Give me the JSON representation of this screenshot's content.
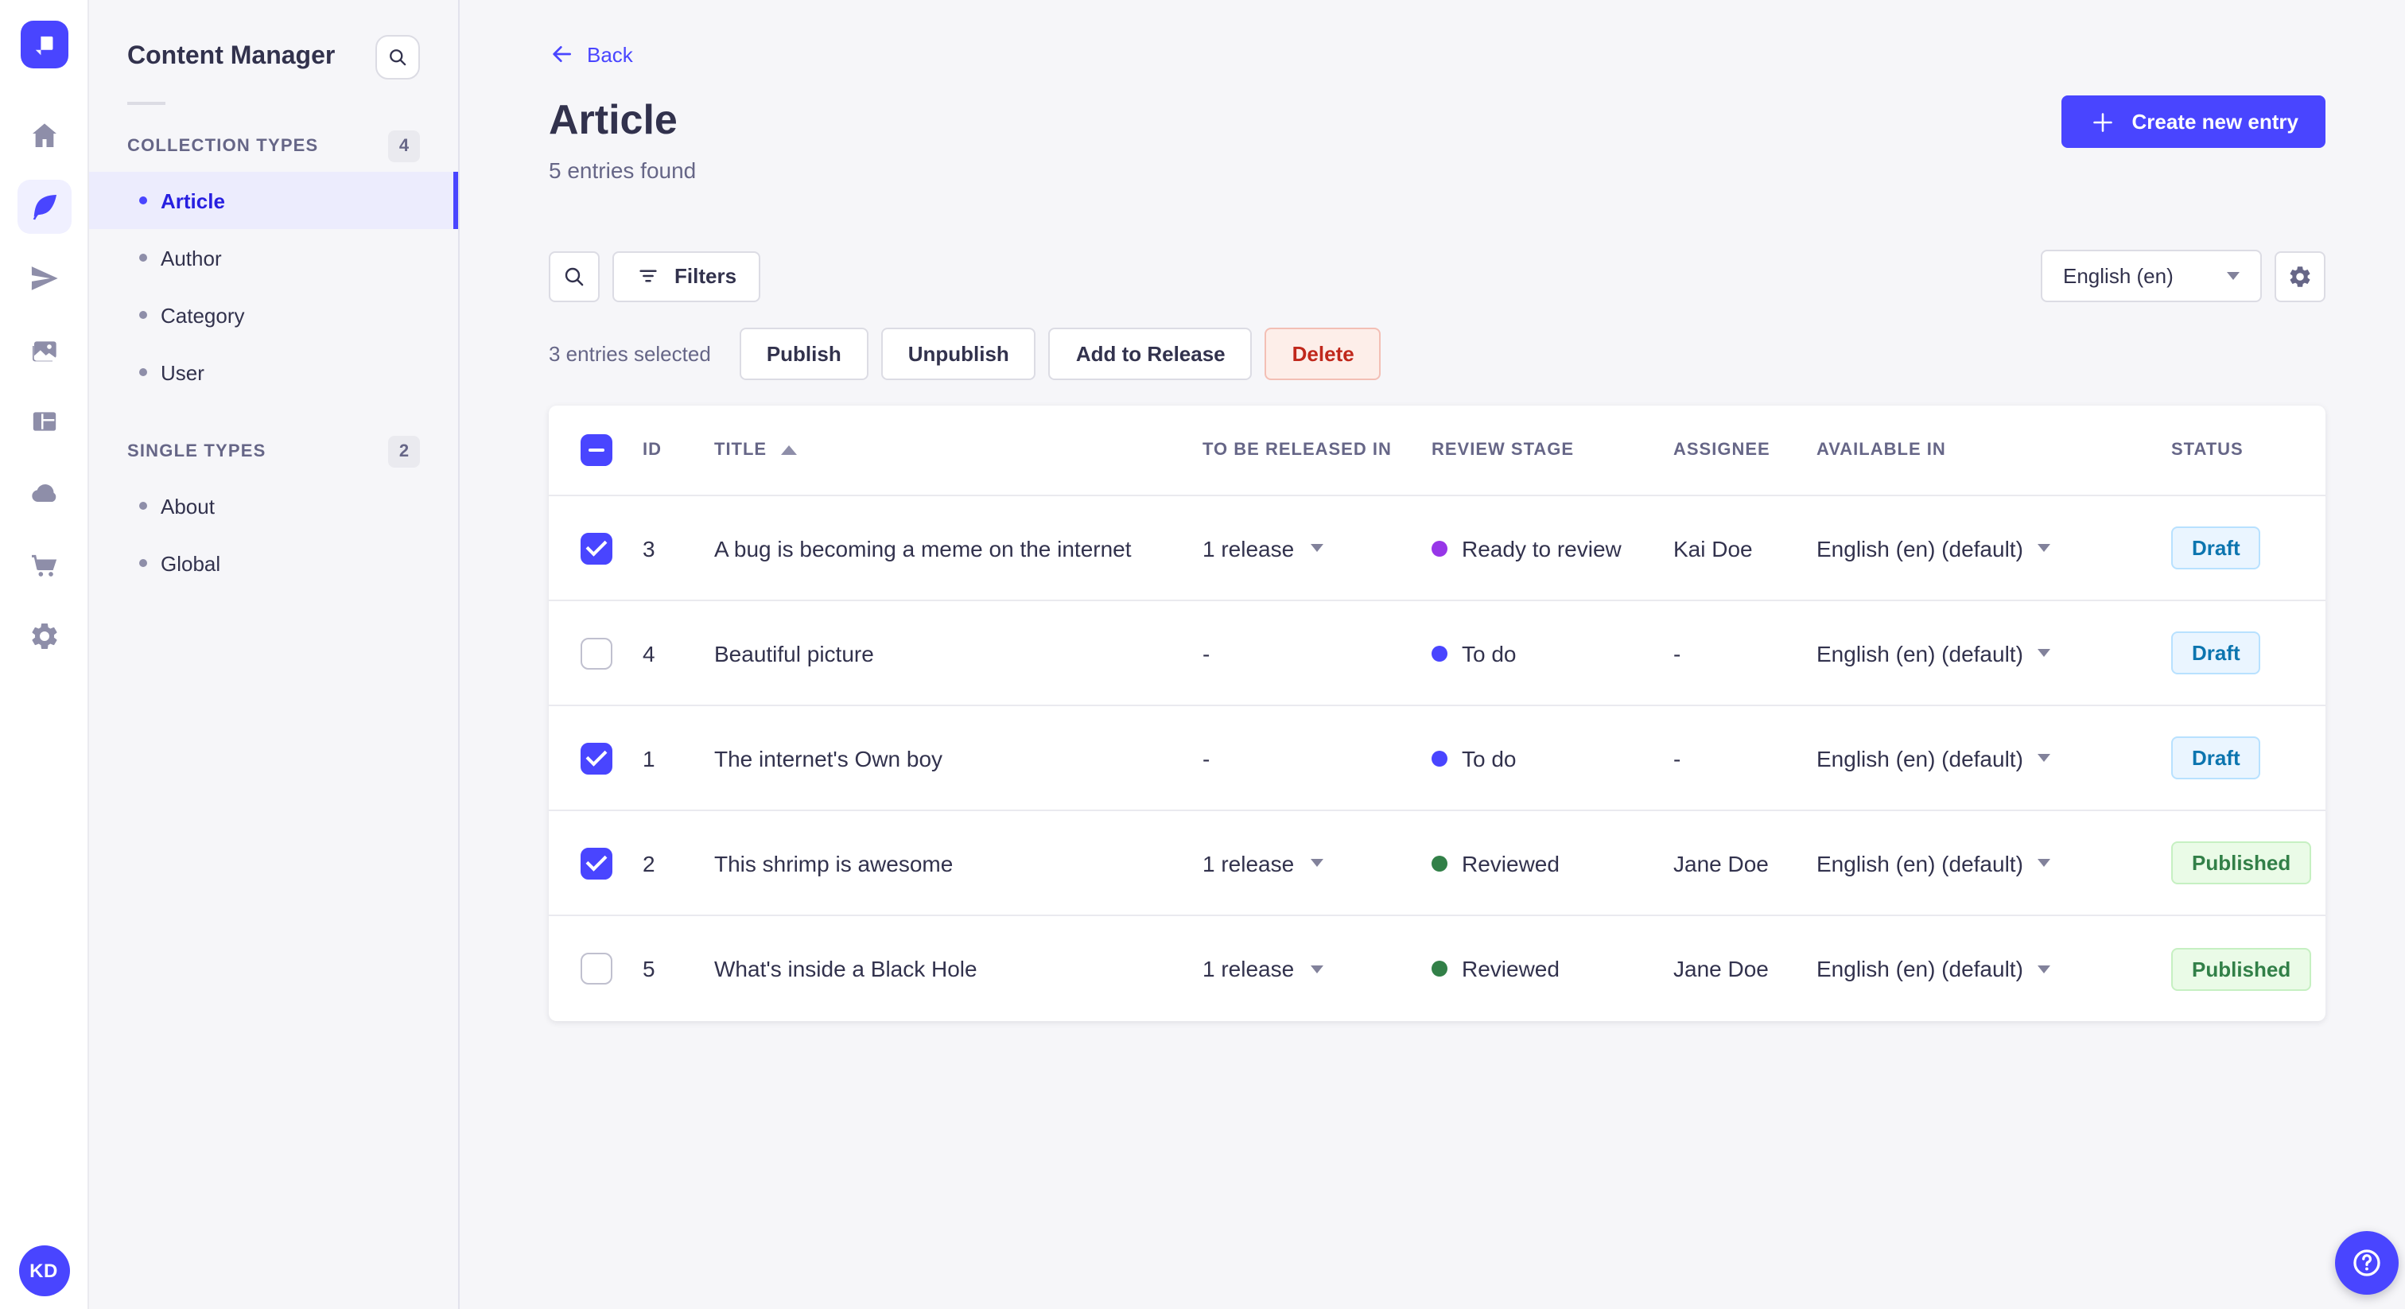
{
  "colors": {
    "accent": "#4945ff",
    "active_item_bg": "#ececfd",
    "stage_ready_to_review": "#9736e8",
    "stage_to_do": "#4945ff",
    "stage_reviewed": "#328048",
    "draft_badge_text": "#0c75af",
    "published_badge_text": "#328048",
    "delete_button_text": "#c0281c"
  },
  "nav": {
    "icons": [
      "home",
      "content-manager",
      "releases",
      "media-library",
      "content-type-builder",
      "cloud",
      "marketplace",
      "settings"
    ],
    "active_icon": "content-manager",
    "avatar_initials": "KD"
  },
  "sidebar": {
    "title": "Content Manager",
    "sections": [
      {
        "label": "COLLECTION TYPES",
        "count": "4",
        "items": [
          {
            "label": "Article",
            "active": true
          },
          {
            "label": "Author",
            "active": false
          },
          {
            "label": "Category",
            "active": false
          },
          {
            "label": "User",
            "active": false
          }
        ]
      },
      {
        "label": "SINGLE TYPES",
        "count": "2",
        "items": [
          {
            "label": "About",
            "active": false
          },
          {
            "label": "Global",
            "active": false
          }
        ]
      }
    ]
  },
  "header": {
    "back_label": "Back",
    "title": "Article",
    "subtitle": "5 entries found",
    "create_label": "Create new entry"
  },
  "toolbar": {
    "filters_label": "Filters",
    "locale_value": "English (en)"
  },
  "selection": {
    "summary": "3 entries selected",
    "publish_label": "Publish",
    "unpublish_label": "Unpublish",
    "add_to_release_label": "Add to Release",
    "delete_label": "Delete"
  },
  "table": {
    "select_all_state": "indeterminate",
    "sort": {
      "column": "TITLE",
      "direction": "asc"
    },
    "headers": {
      "id": "ID",
      "title": "TITLE",
      "release": "TO BE RELEASED IN",
      "stage": "REVIEW STAGE",
      "assignee": "ASSIGNEE",
      "available": "AVAILABLE IN",
      "status": "STATUS"
    },
    "rows": [
      {
        "selected": true,
        "id": "3",
        "title": "A bug is becoming a meme on the internet",
        "release": "1 release",
        "stage": "Ready to review",
        "stage_color": "#9736e8",
        "assignee": "Kai Doe",
        "available": "English (en) (default)",
        "status": "Draft",
        "status_type": "draft"
      },
      {
        "selected": false,
        "id": "4",
        "title": "Beautiful picture",
        "release": "-",
        "stage": "To do",
        "stage_color": "#4945ff",
        "assignee": "-",
        "available": "English (en) (default)",
        "status": "Draft",
        "status_type": "draft"
      },
      {
        "selected": true,
        "id": "1",
        "title": "The internet's Own boy",
        "release": "-",
        "stage": "To do",
        "stage_color": "#4945ff",
        "assignee": "-",
        "available": "English (en) (default)",
        "status": "Draft",
        "status_type": "draft"
      },
      {
        "selected": true,
        "id": "2",
        "title": "This shrimp is awesome",
        "release": "1 release",
        "stage": "Reviewed",
        "stage_color": "#328048",
        "assignee": "Jane Doe",
        "available": "English (en) (default)",
        "status": "Published",
        "status_type": "published"
      },
      {
        "selected": false,
        "id": "5",
        "title": "What's inside a Black Hole",
        "release": "1 release",
        "stage": "Reviewed",
        "stage_color": "#328048",
        "assignee": "Jane Doe",
        "available": "English (en) (default)",
        "status": "Published",
        "status_type": "published"
      }
    ]
  }
}
